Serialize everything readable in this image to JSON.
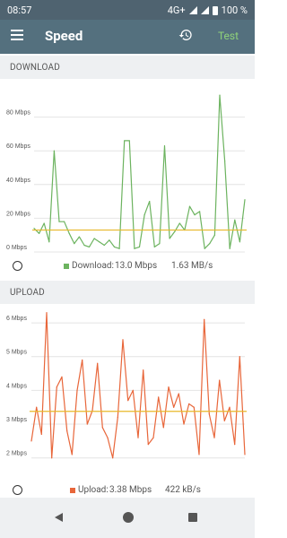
{
  "status_bar": {
    "time": "08:57",
    "network": "4G+",
    "battery": "100 %"
  },
  "app_bar": {
    "title": "Speed",
    "menu_icon": "hamburger-menu-icon",
    "history_icon": "history-icon",
    "test_label": "Test"
  },
  "download": {
    "header": "DOWNLOAD",
    "legend_label": "Download:",
    "speed_mbps": "13.0 Mbps",
    "speed_mbs": "1.63 MB/s"
  },
  "upload": {
    "header": "UPLOAD",
    "legend_label": "Upload:",
    "speed_mbps": "3.38 Mbps",
    "speed_kbs": "422 kB/s"
  },
  "colors": {
    "download_line": "#6cb35f",
    "upload_line": "#e8663a",
    "average_line": "#e8b82a",
    "app_bar": "#54707e",
    "status_bar": "#4f6370"
  },
  "chart_data": [
    {
      "type": "line",
      "title": "DOWNLOAD",
      "ylabel": "Mbps",
      "ylim": [
        0,
        100
      ],
      "y_ticks": [
        "0 Mbps",
        "20 Mbps",
        "40 Mbps",
        "60 Mbps",
        "80 Mbps"
      ],
      "grid": true,
      "average": 13.0,
      "series": [
        {
          "name": "Download",
          "values": [
            14,
            11,
            17,
            6,
            60,
            18,
            18,
            11,
            5,
            9,
            4,
            3,
            8,
            6,
            4,
            7,
            3,
            2,
            66,
            66,
            2,
            3,
            22,
            30,
            3,
            5,
            63,
            8,
            12,
            17,
            13,
            27,
            22,
            24,
            2,
            5,
            10,
            93,
            54,
            2,
            19,
            6,
            31
          ]
        }
      ]
    },
    {
      "type": "line",
      "title": "UPLOAD",
      "ylabel": "Mbps",
      "ylim": [
        1.7,
        6.4
      ],
      "y_ticks": [
        "2 Mbps",
        "3 Mbps",
        "4 Mbps",
        "5 Mbps",
        "6 Mbps"
      ],
      "grid": true,
      "average": 3.38,
      "series": [
        {
          "name": "Upload",
          "values": [
            2.5,
            3.5,
            2.7,
            6.3,
            2.0,
            4.1,
            4.4,
            2.8,
            2.1,
            4.0,
            4.9,
            3.0,
            3.4,
            4.8,
            2.9,
            2.6,
            2.0,
            3.2,
            5.5,
            3.7,
            4.0,
            2.6,
            4.6,
            2.4,
            2.6,
            3.8,
            2.9,
            4.1,
            3.5,
            3.9,
            3.0,
            3.6,
            3.5,
            2.1,
            6.1,
            3.3,
            2.6,
            4.3,
            3.1,
            3.5,
            2.4,
            5.0,
            2.1
          ]
        }
      ]
    }
  ]
}
